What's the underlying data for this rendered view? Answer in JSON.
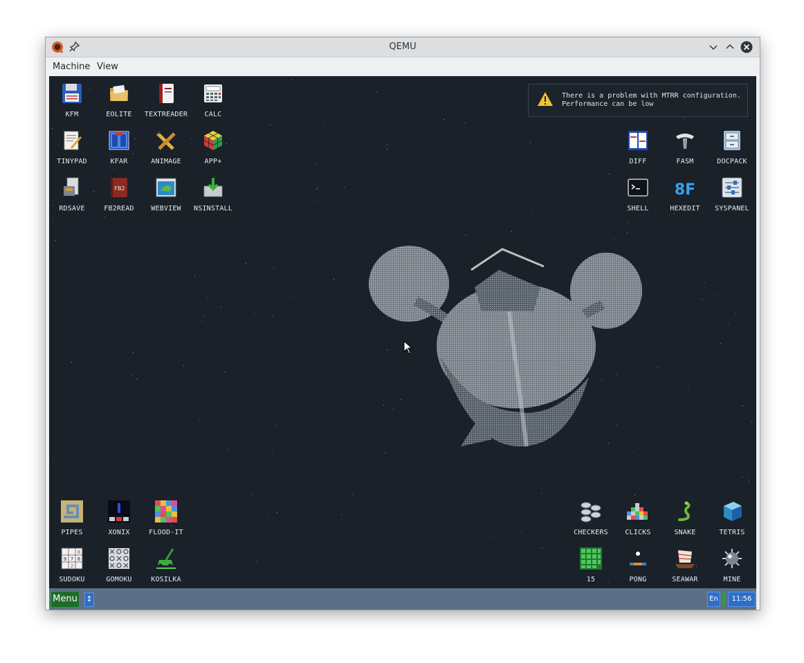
{
  "window": {
    "title": "QEMU"
  },
  "menubar": {
    "items": [
      "Machine",
      "View"
    ]
  },
  "desktop": {
    "icons": {
      "kfm": "KFM",
      "eolite": "EOLITE",
      "textreader": "TEXTREADER",
      "calc": "CALC",
      "tinypad": "TINYPAD",
      "kfar": "KFAR",
      "animage": "ANIMAGE",
      "appplus": "APP+",
      "rdsave": "RDSAVE",
      "fb2read": "FB2READ",
      "webview": "WEBVIEW",
      "nsinstall": "NSINSTALL",
      "diff": "DIFF",
      "fasm": "FASM",
      "docpack": "DOCPACK",
      "shell": "SHELL",
      "hexedit": "HEXEDIT",
      "syspanel": "SYSPANEL",
      "pipes": "PIPES",
      "xonix": "XONIX",
      "floodit": "FLOOD-IT",
      "sudoku": "SUDOKU",
      "gomoku": "GOMOKU",
      "kosilka": "KOSILKA",
      "checkers": "CHECKERS",
      "clicks": "CLICKS",
      "snake": "SNAKE",
      "tetris": "TETRIS",
      "fifteen": "15",
      "pong": "PONG",
      "seawar": "SEAWAR",
      "mine": "MINE"
    },
    "notification": {
      "line1": "There is a problem with MTRR configuration.",
      "line2": "Performance can be low"
    }
  },
  "taskbar": {
    "menu_label": "Menu",
    "switch_glyph": "↕",
    "language": "En",
    "clock": "11:56"
  },
  "icons": {
    "window": [
      "qemu-logo-icon",
      "pin-icon",
      "minimize-icon",
      "maximize-icon",
      "close-icon"
    ],
    "notification": "warning-icon",
    "pointer": "mouse-cursor-icon"
  },
  "colors": {
    "desktop_bg": "#1a2129",
    "taskbar_bg": "#5c6f86",
    "menu_button": "#1f6b2c",
    "taskbar_accent": "#2f6ec8"
  }
}
